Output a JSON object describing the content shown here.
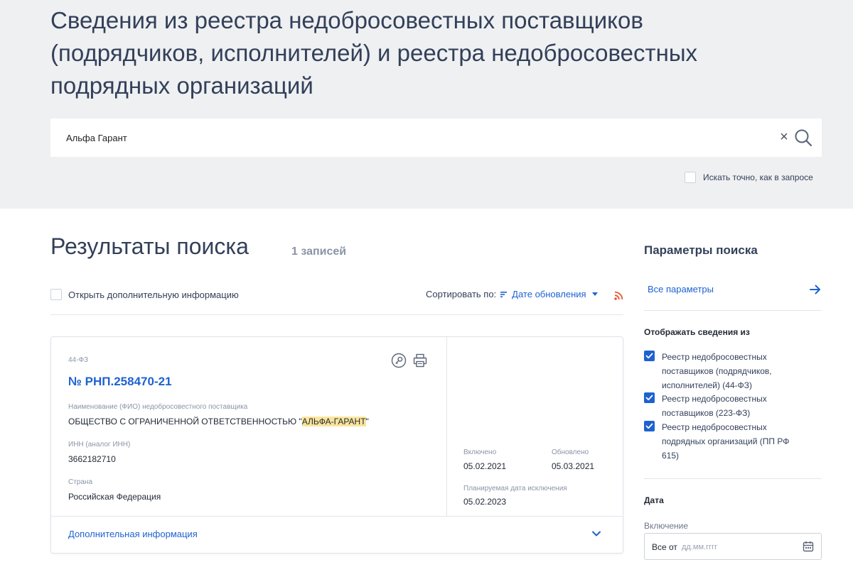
{
  "header": {
    "title": "Сведения из реестра недобросовестных поставщиков (подрядчиков, исполнителей) и реестра недобросовестных подрядных организаций",
    "search": {
      "value": "Альфа Гарант",
      "clear_glyph": "×"
    },
    "exact_search_label": "Искать точно, как в запросе"
  },
  "results": {
    "title": "Результаты поиска",
    "count": "1 записей",
    "open_info_label": "Открыть дополнительную информацию",
    "sort": {
      "label": "Сортировать по:",
      "value": "Дате обновления"
    },
    "cards": [
      {
        "law": "44-ФЗ",
        "number": "№ РНП.258470-21",
        "supplier_label": "Наименование (ФИО) недобросовестного поставщика",
        "supplier_prefix": "ОБЩЕСТВО С ОГРАНИЧЕННОЙ ОТВЕТСТВЕННОСТЬЮ \"",
        "supplier_highlight": "АЛЬФА-ГАРАНТ",
        "supplier_suffix": "\"",
        "inn_label": "ИНН (аналог ИНН)",
        "inn": "3662182710",
        "country_label": "Страна",
        "country": "Российская Федерация",
        "included_label": "Включено",
        "included": "05.02.2021",
        "updated_label": "Обновлено",
        "updated": "05.03.2021",
        "planned_exclusion_label": "Планируемая дата исключения",
        "planned_exclusion": "05.02.2023",
        "more_info_label": "Дополнительная информация"
      }
    ]
  },
  "sidebar": {
    "title": "Параметры поиска",
    "all_params": "Все параметры",
    "show_from_title": "Отображать сведения из",
    "registries": [
      {
        "label": "Реестр недобросовестных поставщиков (подрядчиков, исполнителей) (44-ФЗ)",
        "checked": true
      },
      {
        "label": "Реестр недобросовестных поставщиков (223-ФЗ)",
        "checked": true
      },
      {
        "label": "Реестр недобросовестных подрядных организаций (ПП РФ 615)",
        "checked": true
      }
    ],
    "date_title": "Дата",
    "inclusion_label": "Включение",
    "date_from_prefix": "Все от",
    "date_placeholder": "дд.мм.гггг"
  },
  "colors": {
    "accent": "#1e62d0",
    "header_bg": "#eff0f2",
    "highlight": "#fbe59c",
    "rss": "#e8572a"
  }
}
